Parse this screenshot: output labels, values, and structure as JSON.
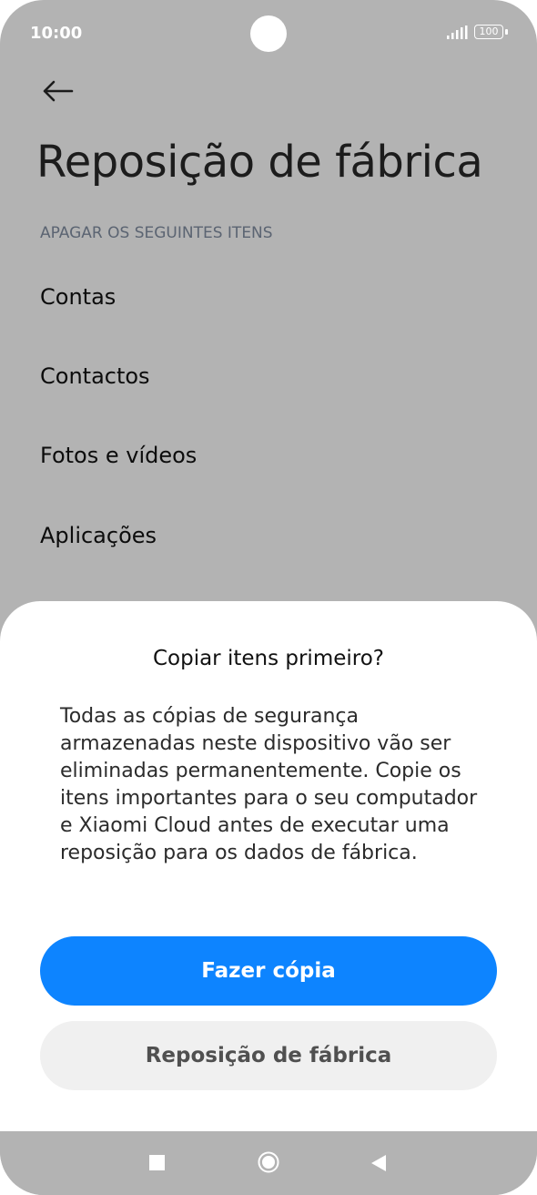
{
  "status_bar": {
    "time": "10:00",
    "battery": "100"
  },
  "page": {
    "title": "Reposição de fábrica",
    "section_header": "APAGAR OS SEGUINTES ITENS",
    "items": [
      "Contas",
      "Contactos",
      "Fotos e vídeos",
      "Aplicações"
    ]
  },
  "dialog": {
    "title": "Copiar itens primeiro?",
    "body": "Todas as cópias de segurança armazenadas neste dispositivo vão ser eliminadas permanentemente. Copie os itens importantes para o seu computador e Xiaomi Cloud antes de executar uma reposição para os dados de fábrica.",
    "primary_button": "Fazer cópia",
    "secondary_button": "Reposição de fábrica"
  },
  "colors": {
    "accent": "#0d84ff",
    "scrim_background": "#b3b3b3",
    "secondary_button_bg": "#f0f0f0"
  },
  "icons": {
    "back": "back-arrow-icon",
    "signal": "signal-icon",
    "battery": "battery-icon",
    "nav_recent": "square-recents-icon",
    "nav_home": "circle-home-icon",
    "nav_back": "triangle-back-icon"
  }
}
